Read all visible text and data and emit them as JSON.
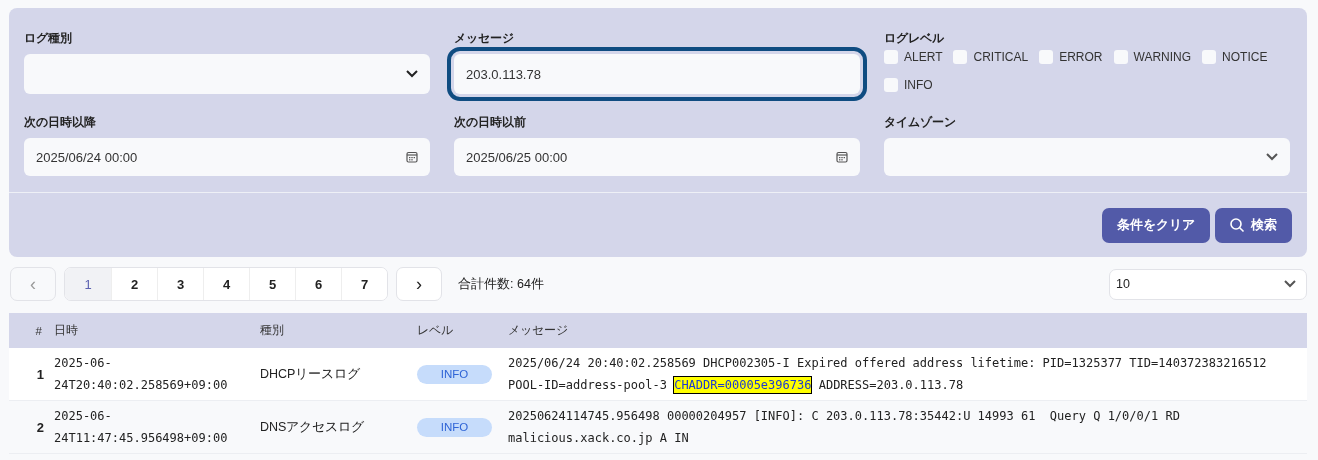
{
  "filters": {
    "log_type": {
      "label": "ログ種別"
    },
    "message": {
      "label": "メッセージ",
      "value": "203.0.113.78",
      "focused": true
    },
    "log_level": {
      "label": "ログレベル",
      "options": [
        {
          "label": "ALERT",
          "checked": false
        },
        {
          "label": "CRITICAL",
          "checked": false
        },
        {
          "label": "ERROR",
          "checked": false
        },
        {
          "label": "WARNING",
          "checked": false
        },
        {
          "label": "NOTICE",
          "checked": false
        },
        {
          "label": "INFO",
          "checked": false
        }
      ]
    },
    "date_from": {
      "label": "次の日時以降",
      "value": "2025/06/24 00:00"
    },
    "date_to": {
      "label": "次の日時以前",
      "value": "2025/06/25 00:00"
    },
    "timezone": {
      "label": "タイムゾーン"
    }
  },
  "buttons": [
    {
      "label": "条件をクリア",
      "kind": "clear"
    },
    {
      "label": "検索",
      "kind": "search"
    }
  ],
  "pagination": {
    "prev": "‹",
    "next": "›",
    "pages": [
      {
        "label": "1",
        "selected": true
      },
      {
        "label": "2",
        "selected": false
      },
      {
        "label": "3",
        "selected": false
      },
      {
        "label": "4",
        "selected": false
      },
      {
        "label": "5",
        "selected": false
      },
      {
        "label": "6",
        "selected": false
      },
      {
        "label": "7",
        "selected": false
      }
    ],
    "total": "合計件数: 64件",
    "page_size": "10"
  },
  "table": {
    "columns": [
      "#",
      "日時",
      "種別",
      "レベル",
      "メッセージ"
    ],
    "rows": [
      {
        "index": "1",
        "datetime": "2025-06-24T20:40:02.258569+09:00",
        "type": "DHCPリースログ",
        "level": "INFO",
        "message": [
          {
            "text": "2025/06/24 20:40:02.258569 DHCP002305-I Expired offered address lifetime: PID=1325377 TID=140372383216512 POOL-ID=address-pool-3 ",
            "highlighted": false
          },
          {
            "text": "CHADDR=00005e396736",
            "highlighted": true
          },
          {
            "text": " ADDRESS=203.0.113.78",
            "highlighted": false
          }
        ]
      },
      {
        "index": "2",
        "datetime": "2025-06-24T11:47:45.956498+09:00",
        "type": "DNSアクセスログ",
        "level": "INFO",
        "message": [
          {
            "text": "20250624114745.956498 00000204957 [INFO]: C 203.0.113.78:35442:U 14993 61  Query Q 1/0/0/1 RD malicious.xack.co.jp A IN",
            "highlighted": false
          }
        ]
      }
    ]
  }
}
